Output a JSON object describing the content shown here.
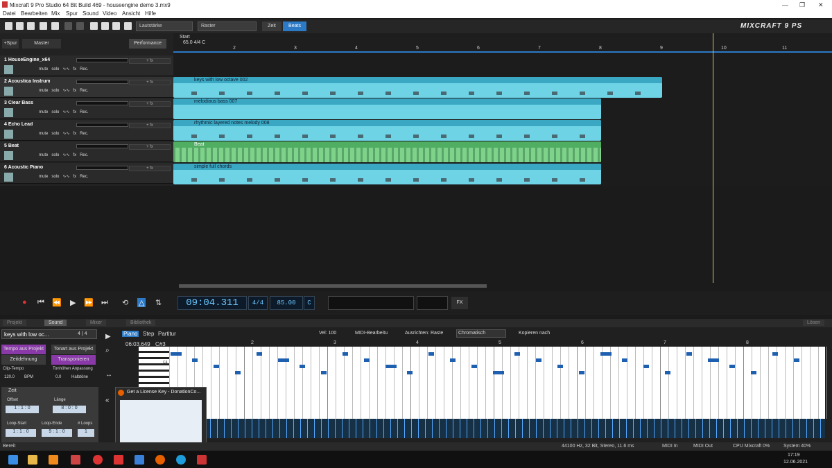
{
  "titlebar": {
    "title": "Mixcraft 9 Pro Studio 64 Bit Build 469 - houseengine demo 3.mx9",
    "min": "—",
    "max": "❐",
    "close": "✕"
  },
  "menu": [
    "Datei",
    "Bearbeiten",
    "Mix",
    "Spur",
    "Sound",
    "Video",
    "Ansicht",
    "Hilfe"
  ],
  "toolbar": {
    "lautstarke": "Lautstärke",
    "raster": "Raster",
    "zeit": "Zeit",
    "beats": "Beats",
    "logo": "MIXCRAFT 9 PS"
  },
  "mixer": {
    "add_track": "+Spur",
    "master": "Master",
    "performance": "Performance"
  },
  "ruler": {
    "start": "Start",
    "pos": "65.0 4/4 C",
    "nums": [
      "2",
      "3",
      "4",
      "5",
      "6",
      "7",
      "8",
      "9",
      "10",
      "11"
    ]
  },
  "tracks": [
    {
      "name": "1 HouseEngine_x64",
      "fx": "+ fx",
      "mute": "mute",
      "solo": "solo",
      "fxl": "fx",
      "rec": "Rec."
    },
    {
      "name": "2 Acoustica Instrum...",
      "fx": "+ fx",
      "mute": "mute",
      "solo": "solo",
      "fxl": "fx",
      "rec": "Rec."
    },
    {
      "name": "3 Clear Bass",
      "fx": "+ fx",
      "mute": "mute",
      "solo": "solo",
      "fxl": "fx",
      "rec": "Rec."
    },
    {
      "name": "4 Echo Lead",
      "fx": "+ fx",
      "mute": "mute",
      "solo": "solo",
      "fxl": "fx",
      "rec": "Rec."
    },
    {
      "name": "5 Beat",
      "fx": "+ fx",
      "mute": "mute",
      "solo": "solo",
      "fxl": "fx",
      "rec": "Rec."
    },
    {
      "name": "6 Acoustic Piano",
      "fx": "+ fx",
      "mute": "mute",
      "solo": "solo",
      "fxl": "fx",
      "rec": "Rec."
    }
  ],
  "clips": [
    "keys with low octave 002",
    "melodious bass 007",
    "rhythmic layered notes melody 008",
    "Beat",
    "simple full chords"
  ],
  "transport": {
    "time": "09:04.311",
    "sig": "4/4",
    "bpm": "85.00",
    "key": "C",
    "fx": "FX"
  },
  "tabs": [
    "Projekt",
    "Sound",
    "Mixer",
    "Bibliothek"
  ],
  "tabs_right": "Lösen",
  "editor": {
    "clipname": "keys with low oc...",
    "sig": "4 | 4",
    "tempo_projekt": "Tempo aus Projekt",
    "zeitdehnung": "Zeitdehnung",
    "tonart": "Tonart aus Projekt",
    "transponieren": "Transponieren",
    "cliptempo": "Clip-Tempo",
    "tonhoehen": "Tonhöhen Anpassung",
    "bpm_val": "120.0",
    "bpm": "BPM",
    "ht_val": "0.0",
    "ht": "Halbtöne",
    "zeit": "Zeit",
    "offset": "Offset",
    "offset_val": "1 : 1 : 0",
    "laenge": "Länge",
    "laenge_val": "8 : 0 : 0",
    "loopstart": "Loop-Start",
    "loopstart_val": "1 : 1 : 0",
    "loopende": "Loop-Ende",
    "loopende_val": "9 : 1 : 0",
    "loops": "# Loops",
    "loops_val": "1",
    "modes": [
      "Piano",
      "Step",
      "Partitur"
    ],
    "vel": "Vel: 100",
    "midibearb": "MIDI-Bearbeitu",
    "ausrichten": "Ausrichten: Raste",
    "chromatisch": "Chromatisch",
    "kopieren": "Kopieren nach",
    "pos": "06:03.649",
    "note": "C#3",
    "c4": "C4",
    "grid_nums": [
      "2",
      "3",
      "4",
      "5",
      "6",
      "7",
      "8"
    ]
  },
  "popup": {
    "title": "Get a License Key - DonationCo..."
  },
  "status": {
    "left": "Bereit",
    "audio": "44100 Hz, 32 Bit, Stereo, 11.6 ms",
    "midiin": "MIDI In",
    "midiout": "MIDI Out",
    "cpu": "CPU Mixcraft 0%",
    "system": "System 40%"
  },
  "clock": {
    "time": "17:19",
    "date": "12.06.2021"
  }
}
